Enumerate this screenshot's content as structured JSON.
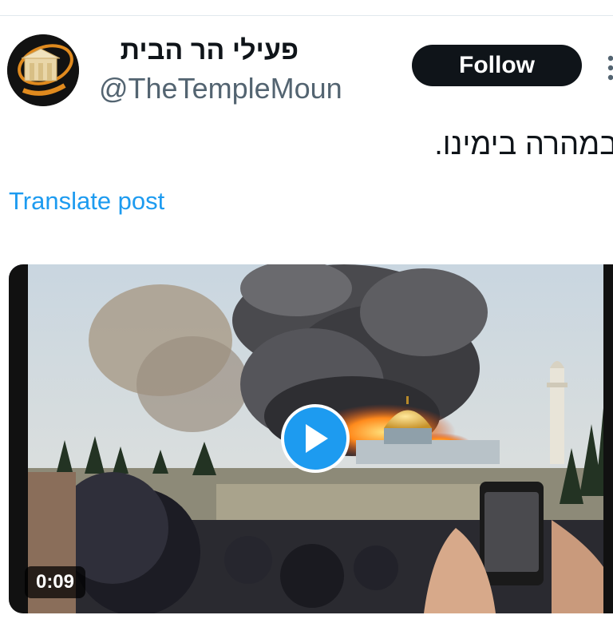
{
  "author": {
    "display_name": "פעילי הר הבית",
    "handle": "@TheTempleMoun",
    "avatar_icon": "temple-logo-icon"
  },
  "follow_label": "Follow",
  "post": {
    "text": "במהרה בימינו.",
    "translate_label": "Translate post"
  },
  "video": {
    "duration": "0:09",
    "play_icon": "play-icon"
  },
  "colors": {
    "accent": "#1d9bf0",
    "follow_bg": "#0f1419",
    "handle": "#536471"
  }
}
